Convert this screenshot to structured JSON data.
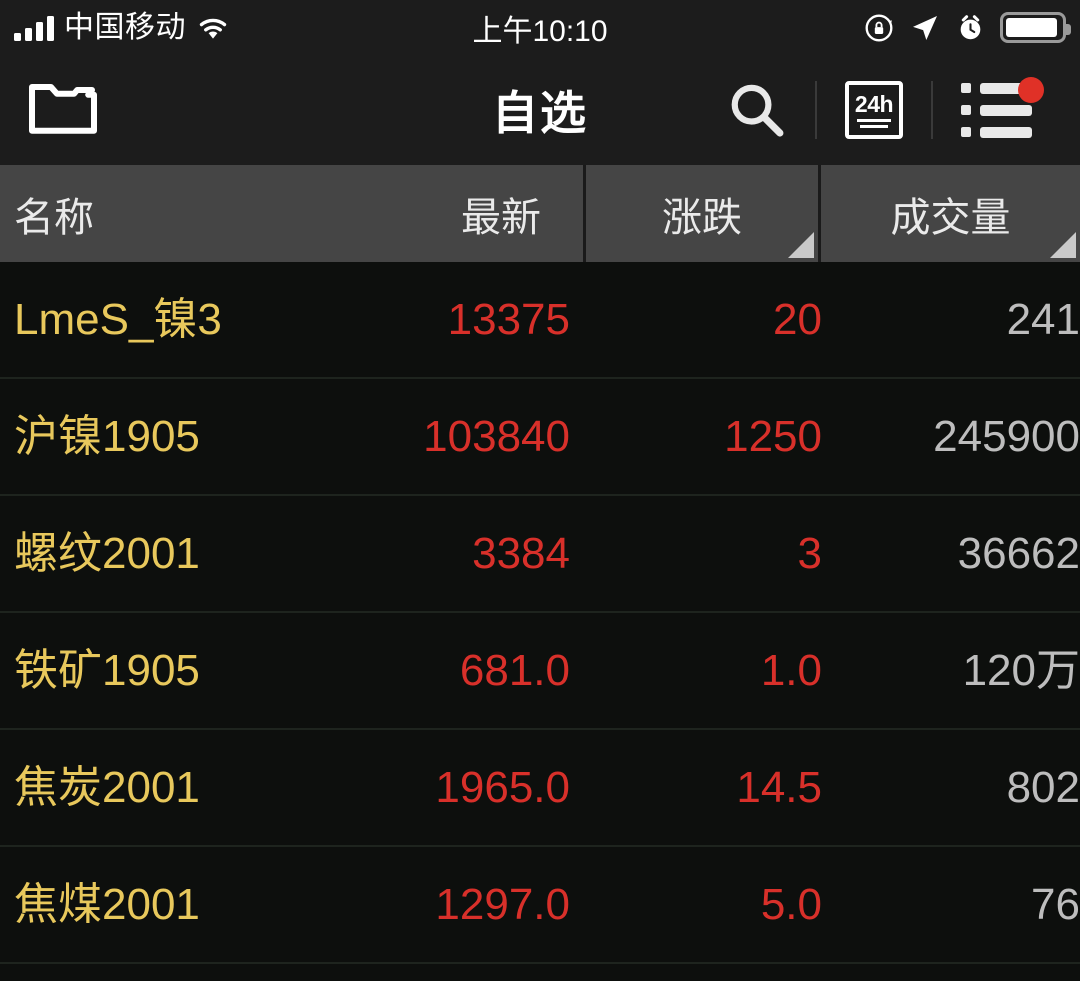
{
  "status_bar": {
    "carrier": "中国移动",
    "time": "上午10:10",
    "signal_bars": 4,
    "icons": [
      "signal-bars-icon",
      "wifi-icon",
      "rotation-lock-icon",
      "location-arrow-icon",
      "alarm-clock-icon",
      "battery-icon"
    ]
  },
  "nav_bar": {
    "title": "自选",
    "folder_icon": "folder-icon",
    "search_icon": "search-icon",
    "news_label": "24h",
    "news_icon": "news-24h-icon",
    "list_icon": "list-menu-icon",
    "badge_visible": true
  },
  "table": {
    "columns": [
      {
        "key": "name",
        "label": "名称",
        "sort_marker": false
      },
      {
        "key": "last",
        "label": "最新",
        "sort_marker": false
      },
      {
        "key": "change",
        "label": "涨跌",
        "sort_marker": true
      },
      {
        "key": "volume",
        "label": "成交量",
        "sort_marker": true
      }
    ],
    "rows": [
      {
        "name": "LmeS_镍3",
        "last": "13375",
        "change": "20",
        "volume": "241"
      },
      {
        "name": "沪镍1905",
        "last": "103840",
        "change": "1250",
        "volume": "245900"
      },
      {
        "name": "螺纹2001",
        "last": "3384",
        "change": "3",
        "volume": "36662"
      },
      {
        "name": "铁矿1905",
        "last": "681.0",
        "change": "1.0",
        "volume": "120万"
      },
      {
        "name": "焦炭2001",
        "last": "1965.0",
        "change": "14.5",
        "volume": "802"
      },
      {
        "name": "焦煤2001",
        "last": "1297.0",
        "change": "5.0",
        "volume": "76"
      }
    ]
  },
  "colors": {
    "up_red": "#d8302a",
    "name_gold": "#e8c85c",
    "volume_gray": "#bdbdbd",
    "header_bg": "#454545",
    "nav_bg": "#1c1c1c",
    "page_bg": "#0d0f0d",
    "badge_red": "#e03127"
  }
}
